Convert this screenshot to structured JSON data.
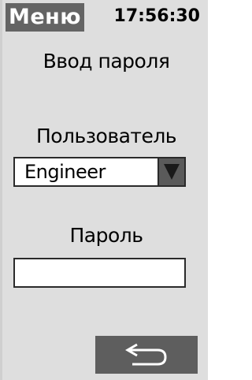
{
  "header": {
    "menu_label": "Меню",
    "clock": "17:56:30"
  },
  "dialog": {
    "title": "Ввод пароля",
    "user_label": "Пользователь",
    "user_value": "Engineer",
    "password_label": "Пароль",
    "password_value": ""
  },
  "icons": {
    "dropdown": "triangle-down-icon",
    "back": "return-arrow-icon"
  },
  "colors": {
    "background": "#dedede",
    "button": "#5e5e5e",
    "field": "#ffffff"
  }
}
